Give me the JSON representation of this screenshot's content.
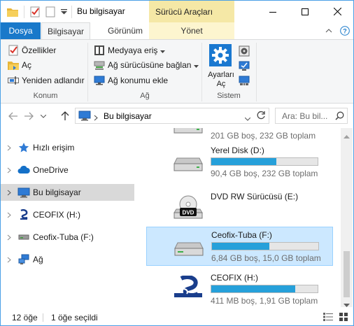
{
  "window": {
    "title": "Bu bilgisayar",
    "contextual_tab_group": "Sürücü Araçları"
  },
  "ribbon_tabs": {
    "file": "Dosya",
    "computer": "Bilgisayar",
    "view": "Görünüm",
    "manage": "Yönet"
  },
  "ribbon": {
    "konum": {
      "properties": "Özellikler",
      "open": "Aç",
      "rename": "Yeniden adlandır",
      "label": "Konum"
    },
    "ag": {
      "media": "Medyaya eriş",
      "map_drive": "Ağ sürücüsüne bağlan",
      "add_location": "Ağ konumu ekle",
      "label": "Ağ"
    },
    "sistem": {
      "settings_line1": "Ayarları",
      "settings_line2": "Aç",
      "label": "Sistem"
    }
  },
  "addressbar": {
    "crumb": "Bu bilgisayar",
    "search_placeholder": "Ara: Bu bil..."
  },
  "nav_pane": [
    {
      "label": "Hızlı erişim"
    },
    {
      "label": "OneDrive"
    },
    {
      "label": "Bu bilgisayar"
    },
    {
      "label": "CEOFIX (H:)"
    },
    {
      "label": "Ceofix-Tuba (F:)"
    },
    {
      "label": "Ağ"
    }
  ],
  "drives": [
    {
      "name": "",
      "size": "201 GB boş, 232 GB toplam",
      "used_fraction": 0.13
    },
    {
      "name": "Yerel Disk (D:)",
      "size": "90,4 GB boş, 232 GB toplam",
      "used_fraction": 0.61
    },
    {
      "name": "DVD RW Sürücüsü (E:)",
      "size": "",
      "dvd_label": "DVD"
    },
    {
      "name": "Ceofix-Tuba (F:)",
      "size": "6,84 GB boş, 15,0 GB toplam",
      "used_fraction": 0.54
    },
    {
      "name": "CEOFIX (H:)",
      "size": "411 MB boş, 1,91 GB toplam",
      "used_fraction": 0.79
    }
  ],
  "status": {
    "items": "12 öğe",
    "selected": "1 öğe seçildi"
  },
  "colors": {
    "accent": "#1979ca",
    "contextual": "#f5e8a6",
    "selection": "#cce8ff",
    "bar_fill": "#26a0da"
  }
}
